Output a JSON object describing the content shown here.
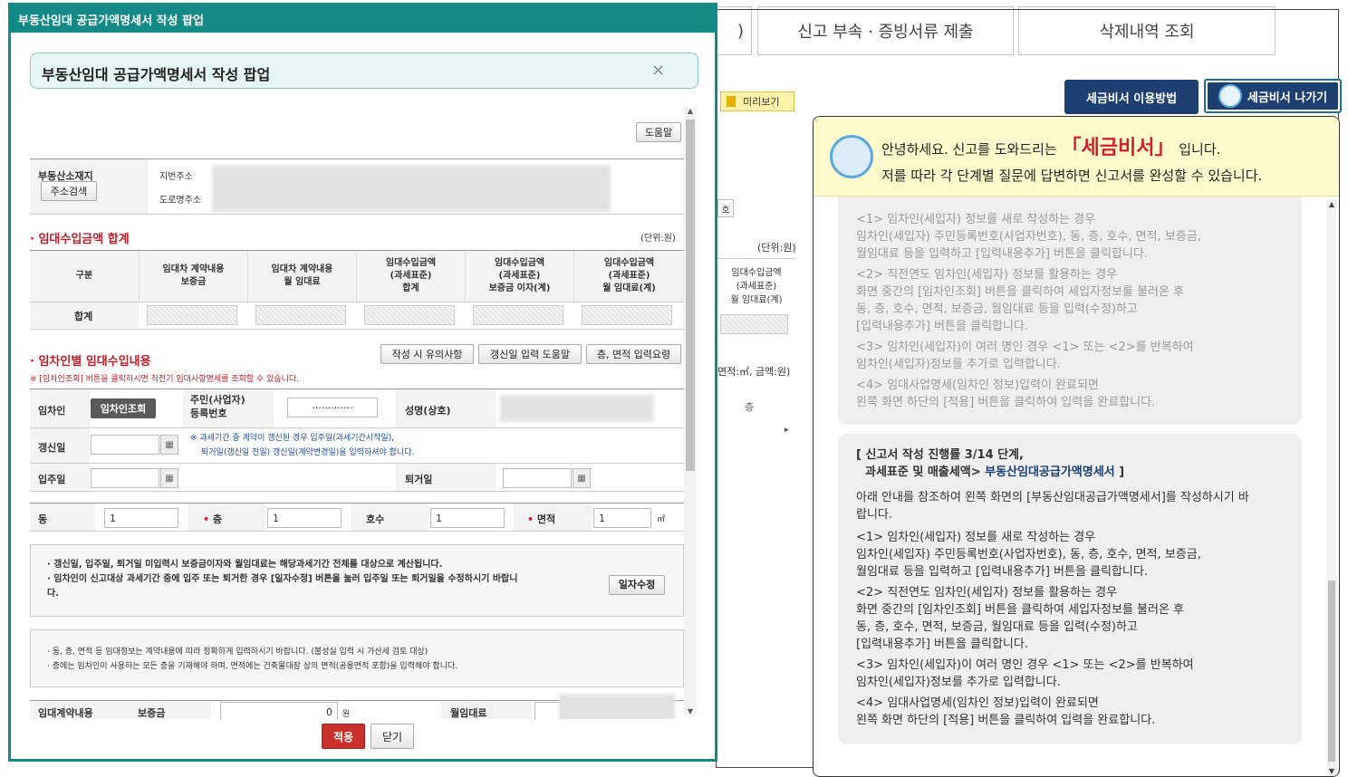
{
  "tabs": {
    "partial": ")",
    "attach": "신고 부속 · 증빙서류 제출",
    "deleted": "삭제내역 조회"
  },
  "secretary": {
    "howto": "세금비서 이용방법",
    "exit": "세금비서 나가기"
  },
  "bg": {
    "preview": "미리보기",
    "unit": "(단위:원)",
    "col_label": "임대수입금액\n(과세표준)\n월 임대료(계)",
    "unit2": "면적:㎡, 금액:원)",
    "floor": "층",
    "ho": "호"
  },
  "assistant": {
    "greet_pre": "안녕하세요. 신고를 도와드리는 ",
    "name": "「세금비서」",
    "greet_post": " 입니다.",
    "line2": "저를 따라 각 단계별 질문에 답변하면 신고서를 완성할 수 있습니다.",
    "faded": [
      "<1> 임차인(세입자) 정보를 새로 작성하는 경우",
      "임차인(세입자) 주민등록번호(사업자번호), 동, 층, 호수, 면적, 보증금,",
      "월임대료 등을 입력하고 [입력내용추가] 버튼을 클릭합니다.",
      "<2> 직전연도 임차인(세입자) 정보를 활용하는 경우",
      "화면 중간의 [임차인조회] 버튼을 클릭하여 세입자정보를 불러온 후",
      "동, 층, 호수, 면적, 보증금, 월임대료 등을 입력(수정)하고",
      "[입력내용추가] 버튼을 클릭합니다.",
      "<3> 임차인(세입자)이 여러 명인 경우 <1> 또는 <2>를 반복하여",
      "임차인(세입자)정보를 추가로 입력합니다.",
      "<4> 임대사업명세(임차인 정보)입력이 완료되면",
      "왼쪽 화면 하단의 [적용] 버튼을 클릭하여 입력을 완료합니다."
    ],
    "step_line1": "[ 신고서 작성 진행률 3/14 단계,",
    "step_line2a": "과세표준 및 매출세액> ",
    "step_line2b": "부동산임대공급가액명세서",
    "step_line2c": " ]",
    "intro": "아래 안내를 참조하여 왼쪽 화면의 [부동산임대공급가액명세서]를 작성하시기 바랍니다.",
    "active": [
      "<1> 임차인(세입자) 정보를 새로 작성하는 경우",
      "임차인(세입자) 주민등록번호(사업자번호), 동, 층, 호수, 면적, 보증금,",
      "월임대료 등을 입력하고 [입력내용추가] 버튼을 클릭합니다.",
      "<2> 직전연도 임차인(세입자) 정보를 활용하는 경우",
      "화면 중간의 [임차인조회] 버튼을 클릭하여 세입자정보를 불러온 후",
      "동, 층, 호수, 면적, 보증금, 월임대료 등을 입력(수정)하고",
      "[입력내용추가] 버튼을 클릭합니다.",
      "<3> 임차인(세입자)이 여러 명인 경우 <1> 또는 <2>를 반복하여",
      "임차인(세입자)정보를 추가로 입력합니다.",
      "<4> 임대사업명세(임차인 정보)입력이 완료되면",
      "왼쪽 화면 하단의 [적용] 버튼을 클릭하여 입력을 완료합니다."
    ]
  },
  "popup": {
    "titlebar": "부동산임대 공급가액명세서 작성 팝업",
    "heading": "부동산임대 공급가액명세서 작성 팝업",
    "help": "도움말",
    "location_label": "부동산소재지",
    "addr_search": "주소검색",
    "jibun": "지번주소",
    "road": "도로명주소",
    "sum_title": "임대수입금액 합계",
    "unit": "(단위:원)",
    "sum_headers": [
      "구분",
      "임대차 계약내용\n보증금",
      "임대차 계약내용\n월 임대료",
      "임대수입금액\n(과세표준)\n합계",
      "임대수입금액\n(과세표준)\n보증금 이자(계)",
      "임대수입금액\n(과세표준)\n월 임대료(계)"
    ],
    "sum_row": "합계",
    "tenant_title": "임차인별 임대수입내용",
    "btn_caution": "작성 시 유의사항",
    "btn_renew_help": "갱신일 입력 도움말",
    "btn_floor_help": "층, 면적 입력요령",
    "notice": "※ [임차인조회] 버튼을 클릭하시면 직전기 임대사항명세를 조회할 수 있습니다.",
    "tenant": "임차인",
    "tenant_search": "임차인조회",
    "id_label": "주민(사업자)\n등록번호",
    "id_value": "·············",
    "name_label": "성명(상호)",
    "renew": "갱신일",
    "renew_note1": "※ 과세기간 중 계약이 갱신된 경우 입주일(과세기간시작일),",
    "renew_note2": "퇴거일(갱신일 전일) 갱신일(계약변경일)을 입력하셔야 합니다.",
    "movein": "입주일",
    "moveout": "퇴거일",
    "dong": "동",
    "dong_val": "1",
    "floor": "층",
    "floor_val": "1",
    "ho": "호수",
    "ho_val": "1",
    "area": "면적",
    "area_val": "1",
    "area_unit": "㎡",
    "info1": "갱신일, 입주일, 퇴거일 미입력시 보증금이자와 월임대료는 해당과세기간 전체를 대상으로 계산됩니다.",
    "info2": "임차인이 신고대상 과세기간 중에 입주 또는 퇴거한 경우 [일자수정] 버튼을 눌러 입주일 또는 퇴거일을 수정하시기 바랍니다.",
    "date_fix": "일자수정",
    "info3": "동, 층, 면적 등 임대정보는 계약내용에 따라 정확하게 입력하시기 바랍니다. (불성실 입력 시 가산세 검토 대상)",
    "info4": "층에는 임차인이 사용하는 모든 층을 기재해야 하며, 면적에는 건축물대장 상의 면적(공용면적 포함)을 입력해야 합니다.",
    "contract": "임대계약내용",
    "deposit": "보증금",
    "deposit_val": "0",
    "won": "원",
    "monthly": "월임대료",
    "apply": "적용",
    "close": "닫기"
  }
}
